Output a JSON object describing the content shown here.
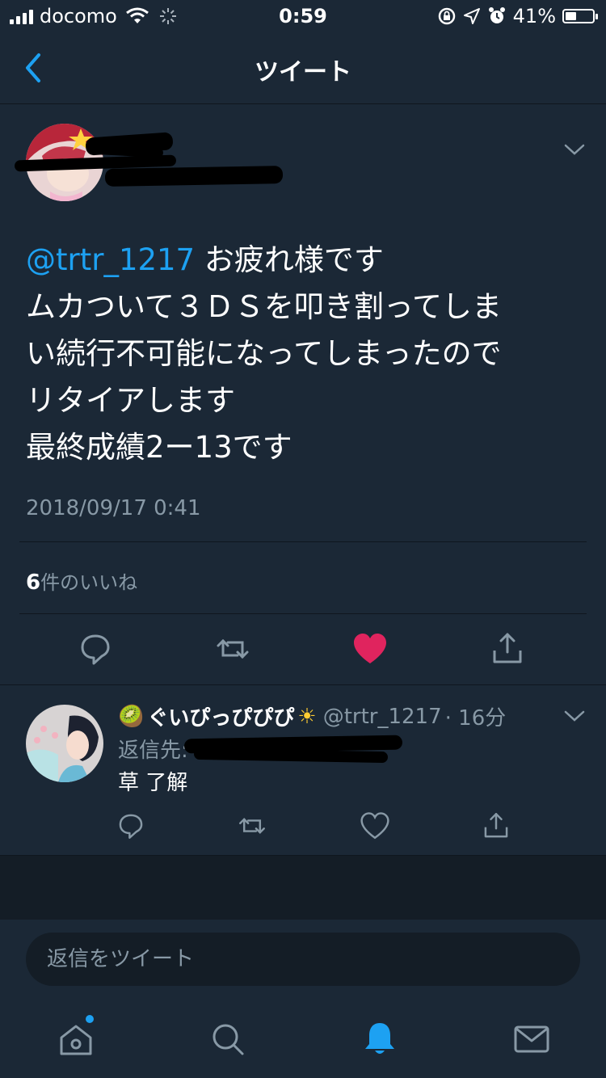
{
  "status_bar": {
    "carrier": "docomo",
    "time": "0:59",
    "battery_percent": "41%",
    "battery_level": 0.41
  },
  "nav": {
    "title": "ツイート",
    "back_icon": "chevron-left-icon"
  },
  "tweet": {
    "mention": "@trtr_1217",
    "text_line1_rest": " お疲れ様です",
    "text_line2": "ムカついて３ＤＳを叩き割ってしま",
    "text_line3": "い続行不可能になってしまったので",
    "text_line4": "リタイアします",
    "text_line5": "最終成績2ー13です",
    "timestamp": "2018/09/17 0:41",
    "likes_count": "6",
    "likes_label": "件のいいね",
    "liked": true
  },
  "reply": {
    "emoji_prefix": "🥝",
    "display_name": "ぐいぴっぴぴぴ",
    "emoji_suffix": "☀",
    "handle": "@trtr_1217",
    "time": "· 16分",
    "reply_to_label": "返信先:",
    "text": "草 了解"
  },
  "composer": {
    "placeholder": "返信をツイート"
  },
  "tabs": [
    "home-icon",
    "search-icon",
    "notifications-icon",
    "messages-icon"
  ],
  "colors": {
    "background": "#141d26",
    "surface": "#1b2836",
    "accent": "#1da1f2",
    "like": "#e0245e",
    "muted": "#8899a6"
  }
}
